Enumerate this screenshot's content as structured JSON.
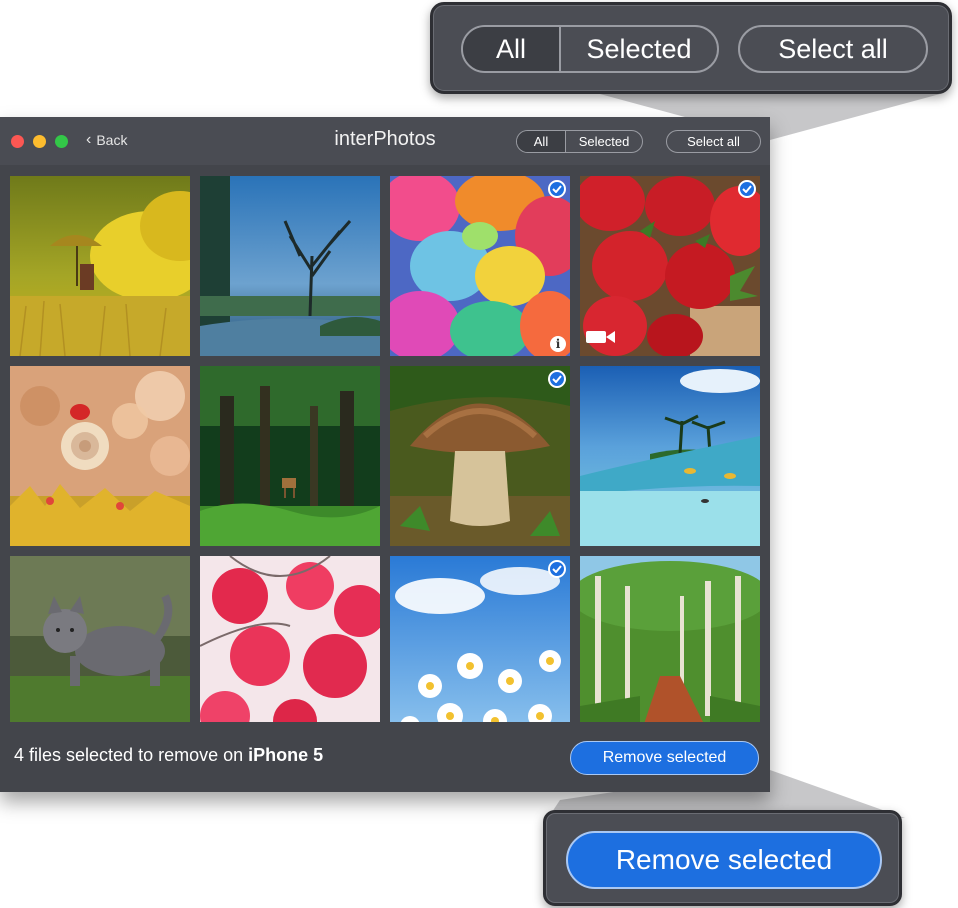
{
  "callout_top": {
    "segment_all": "All",
    "segment_selected": "Selected",
    "select_all": "Select all"
  },
  "window": {
    "title": "interPhotos",
    "back_label": "Back",
    "segment_all": "All",
    "segment_selected": "Selected",
    "select_all": "Select all"
  },
  "photos": [
    {
      "subject": "umbrella-figure-yellow-field",
      "selected": false
    },
    {
      "subject": "tree-river-blue",
      "selected": false
    },
    {
      "subject": "colorful-powder",
      "selected": true,
      "badge": "info-icon"
    },
    {
      "subject": "strawberries",
      "selected": true,
      "badge": "video-icon"
    },
    {
      "subject": "ladybug-snail-bokeh",
      "selected": false
    },
    {
      "subject": "deer-forest",
      "selected": false
    },
    {
      "subject": "mushroom",
      "selected": true
    },
    {
      "subject": "tropical-island-water",
      "selected": false
    },
    {
      "subject": "kitten-grass",
      "selected": false
    },
    {
      "subject": "frosted-red-berries",
      "selected": false
    },
    {
      "subject": "daisies-sky",
      "selected": true
    },
    {
      "subject": "birch-forest-path",
      "selected": false
    }
  ],
  "footer": {
    "status_prefix": "4 files selected to remove on ",
    "device_name": "iPhone 5",
    "remove_button": "Remove selected"
  },
  "callout_bottom": {
    "remove_button": "Remove selected"
  },
  "colors": {
    "window_bg": "#43454b",
    "accent_blue": "#1d6fe0",
    "traffic_red": "#fc5753",
    "traffic_yellow": "#fdbc2e",
    "traffic_green": "#33c748"
  }
}
